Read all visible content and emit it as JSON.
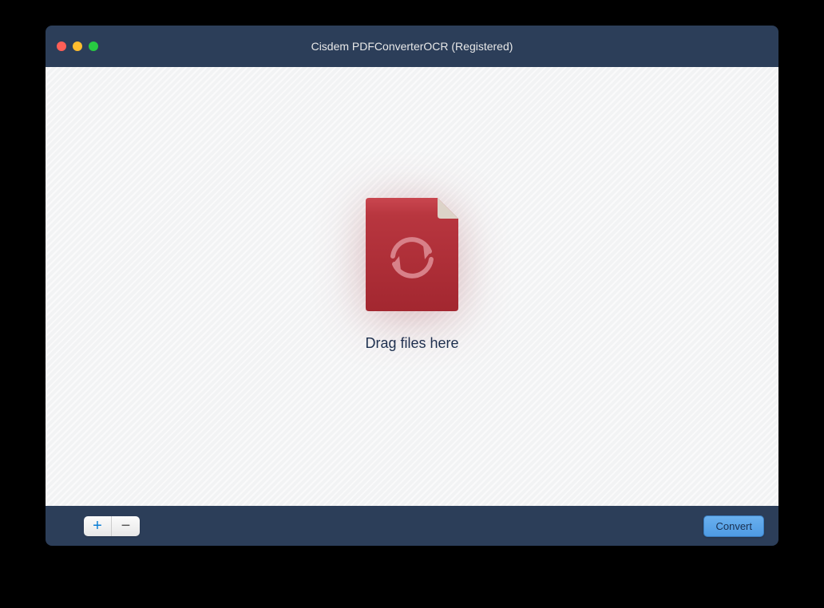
{
  "window": {
    "title": "Cisdem PDFConverterOCR (Registered)"
  },
  "content": {
    "drop_hint": "Drag files here"
  },
  "toolbar": {
    "add_label": "+",
    "remove_label": "−",
    "convert_label": "Convert"
  },
  "colors": {
    "titlebar_bg": "#2c3e59",
    "file_icon_fill": "#ab2a33",
    "file_icon_top": "#c9464f",
    "convert_btn": "#5aa4e8"
  }
}
